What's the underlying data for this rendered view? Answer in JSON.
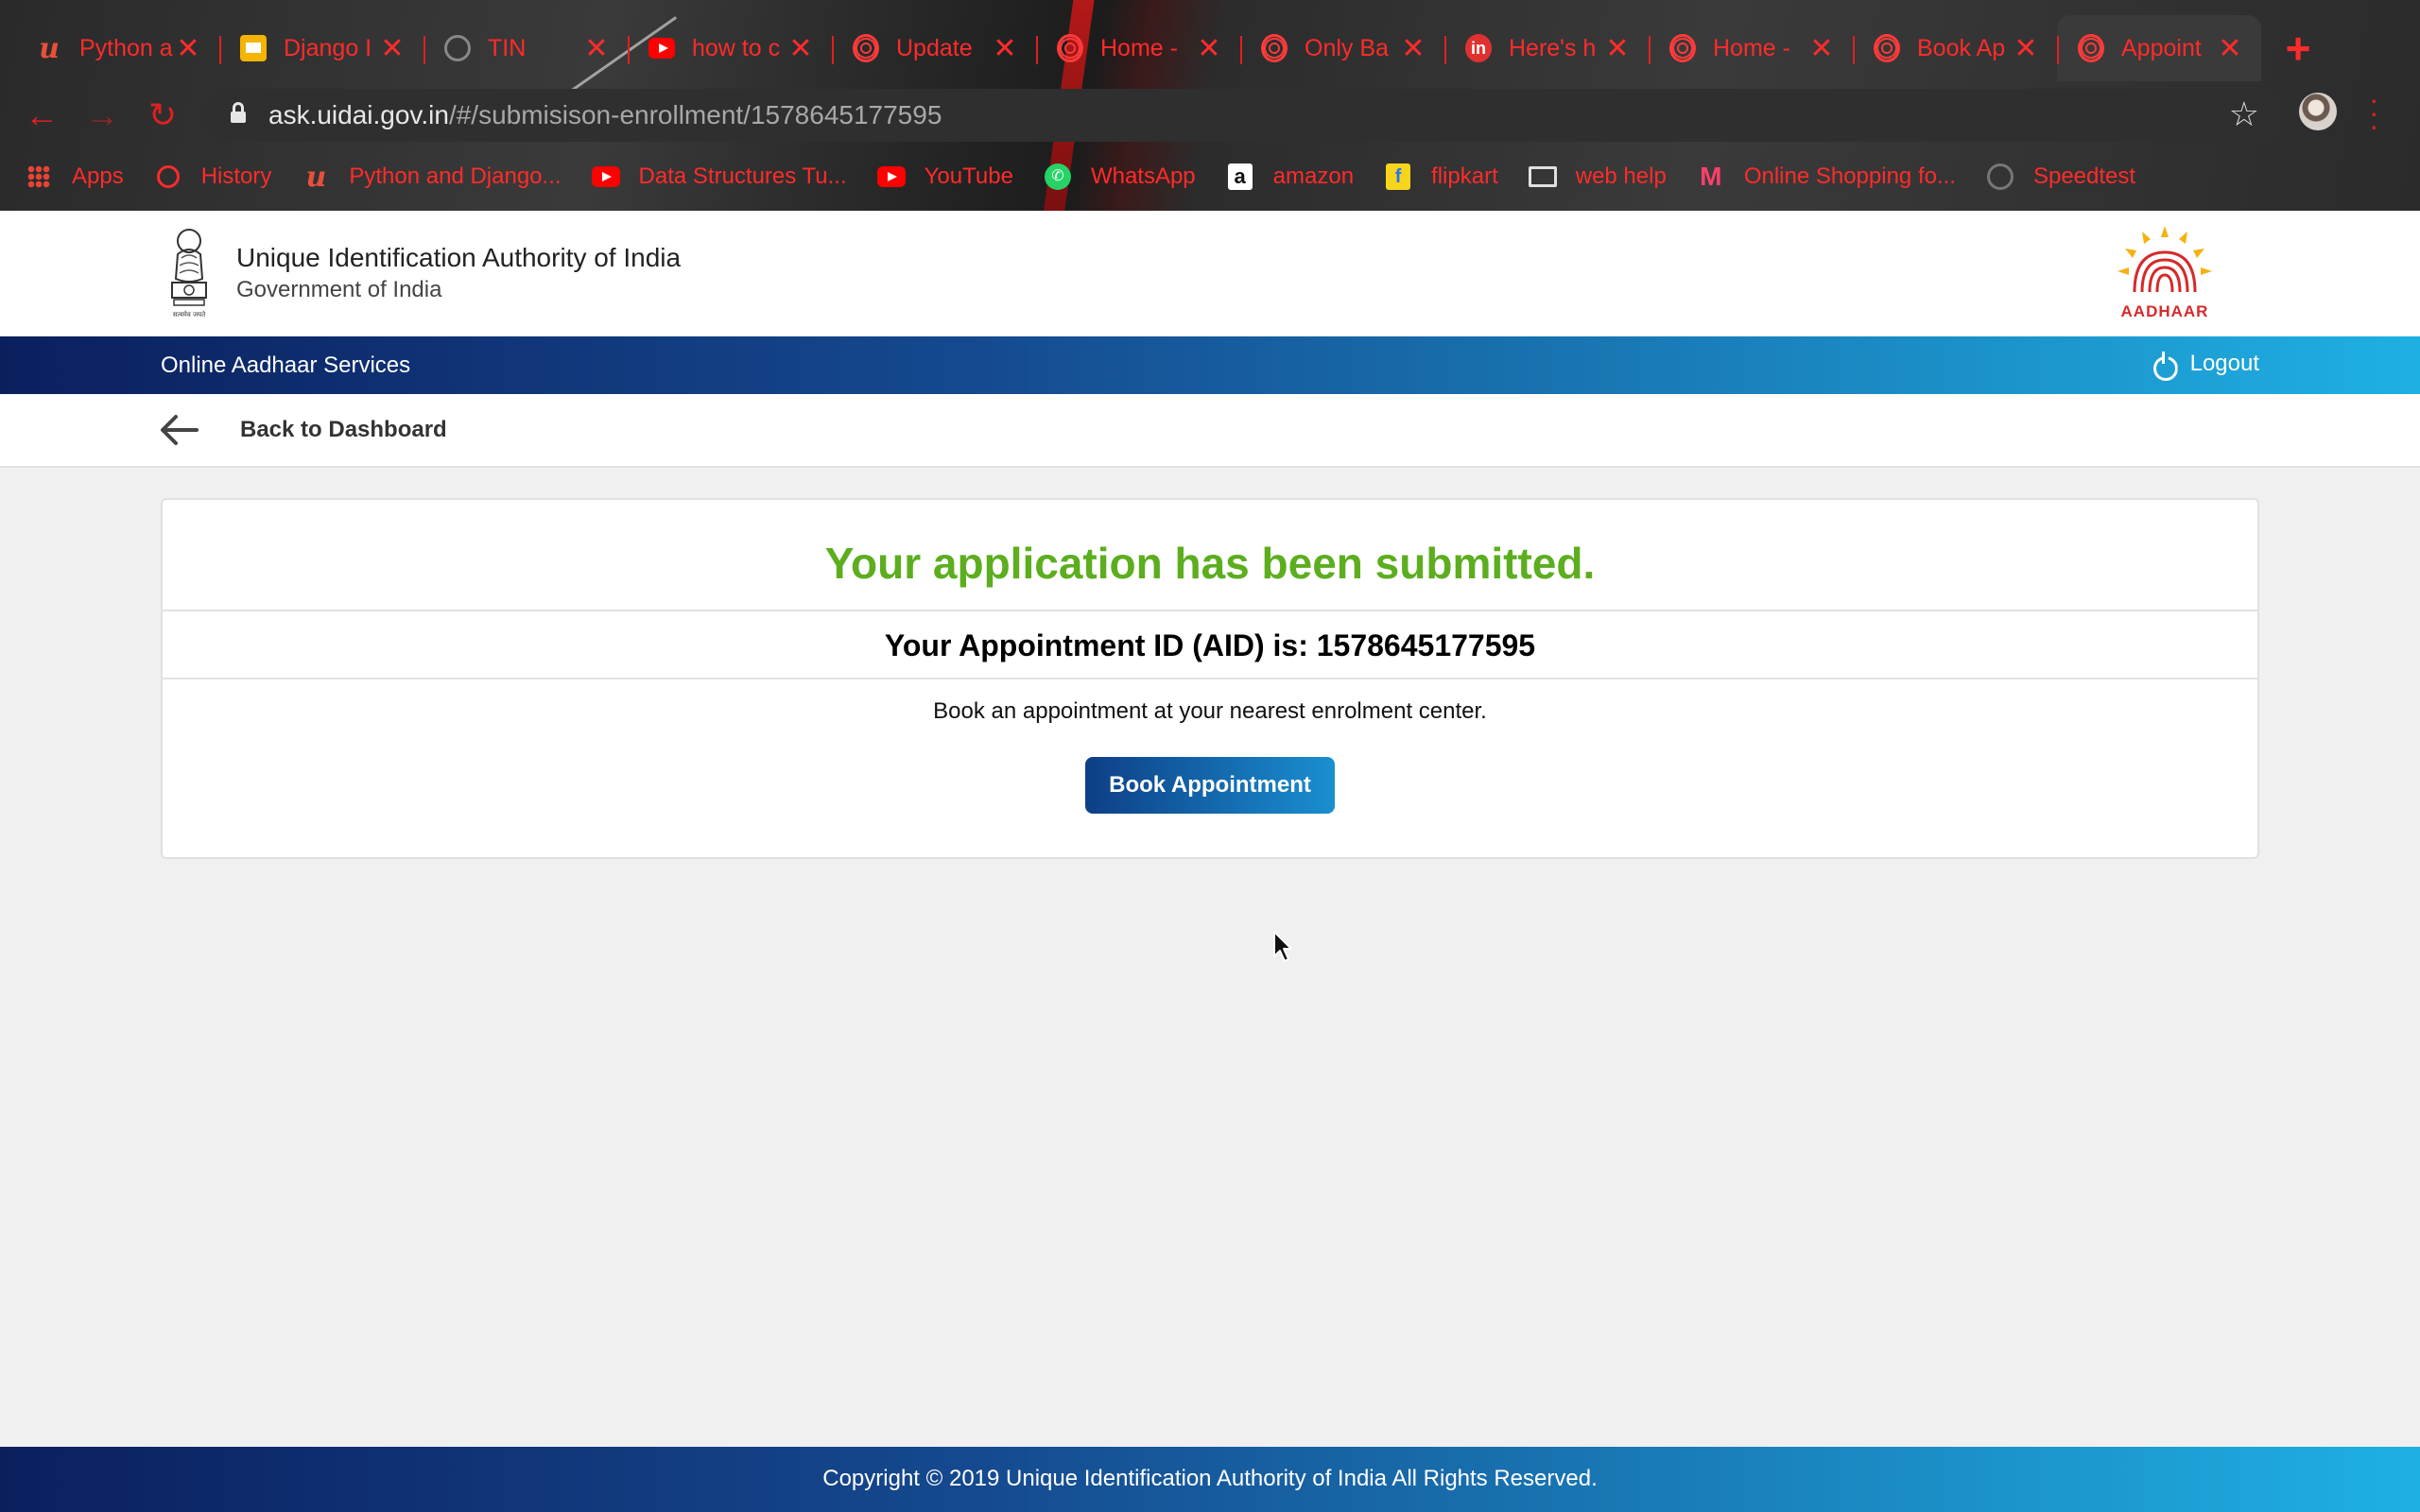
{
  "browser": {
    "tabs": [
      {
        "title": "Python a",
        "icon": "udemy-icon"
      },
      {
        "title": "Django I",
        "icon": "slides-icon"
      },
      {
        "title": "TIN",
        "icon": "globe-icon"
      },
      {
        "title": "how to c",
        "icon": "youtube-icon"
      },
      {
        "title": "Update",
        "icon": "aadhaar-icon"
      },
      {
        "title": "Home -",
        "icon": "aadhaar-icon"
      },
      {
        "title": "Only Ba",
        "icon": "aadhaar-icon"
      },
      {
        "title": "Here's h",
        "icon": "in-icon"
      },
      {
        "title": "Home -",
        "icon": "aadhaar-icon"
      },
      {
        "title": "Book Ap",
        "icon": "aadhaar-icon"
      },
      {
        "title": "Appoint",
        "icon": "aadhaar-icon"
      }
    ],
    "url_host": "ask.uidai.gov.in",
    "url_path": "/#/submisison-enrollment/1578645177595",
    "bookmarks": [
      {
        "label": "Apps",
        "icon": "apps-grid-icon"
      },
      {
        "label": "History",
        "icon": "history-icon"
      },
      {
        "label": "Python and Django...",
        "icon": "udemy-icon"
      },
      {
        "label": "Data Structures Tu...",
        "icon": "youtube-icon"
      },
      {
        "label": "YouTube",
        "icon": "youtube-icon"
      },
      {
        "label": "WhatsApp",
        "icon": "whatsapp-icon"
      },
      {
        "label": "amazon",
        "icon": "amazon-icon"
      },
      {
        "label": "flipkart",
        "icon": "flipkart-icon"
      },
      {
        "label": "web help",
        "icon": "folder-icon"
      },
      {
        "label": "Online Shopping fo...",
        "icon": "myntra-icon"
      },
      {
        "label": "Speedtest",
        "icon": "speedtest-icon"
      }
    ],
    "accent_color": "#ff2b2b"
  },
  "header": {
    "org_name": "Unique Identification Authority of India",
    "org_subtitle": "Government of India",
    "emblem_caption": "सत्यमेव जयते",
    "logo_text": "AADHAAR"
  },
  "navbar": {
    "title": "Online Aadhaar Services",
    "logout_label": "Logout"
  },
  "back": {
    "label": "Back to Dashboard"
  },
  "card": {
    "title": "Your application has been submitted.",
    "aid_text": "Your Appointment ID (AID) is: 1578645177595",
    "message": "Book an appointment at your nearest enrolment center.",
    "button_label": "Book Appointment",
    "title_color": "#5cae1e"
  },
  "footer": {
    "text": "Copyright © 2019 Unique Identification Authority of India All Rights Reserved."
  }
}
